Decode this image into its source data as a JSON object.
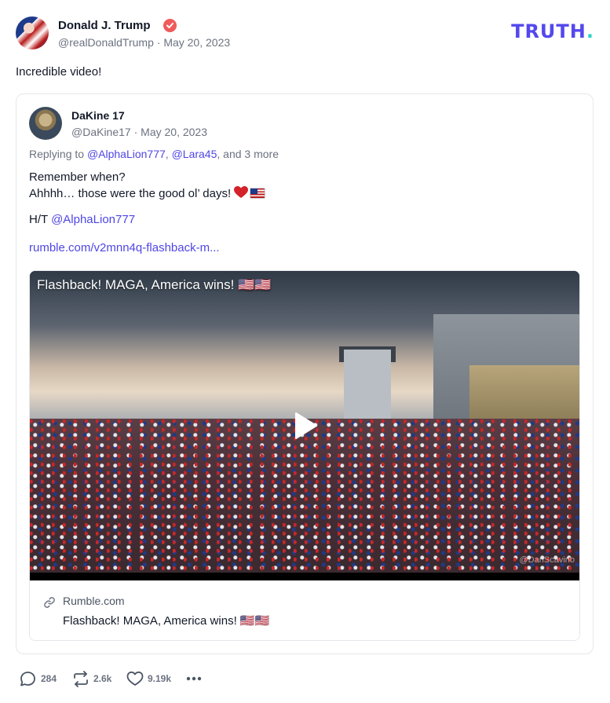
{
  "post": {
    "author_name": "Donald J. Trump",
    "handle": "@realDonaldTrump",
    "date": "May 20, 2023",
    "text": "Incredible video!"
  },
  "brand": {
    "name": "TRUTH",
    "dot": "."
  },
  "quote": {
    "author_name": "DaKine 17",
    "handle": "@DaKine17",
    "date": "May 20, 2023",
    "reply_prefix": "Replying to ",
    "reply_user1": "@AlphaLion777",
    "reply_sep": ", ",
    "reply_user2": "@Lara45",
    "reply_suffix": ", and 3 more",
    "line1": "Remember when?",
    "line2": "Ahhhh… those were the good ol’ days!",
    "ht_prefix": "H/T ",
    "ht_user": "@AlphaLion777",
    "url": "rumble.com/v2mnn4q-flashback-m..."
  },
  "media": {
    "video_title": "Flashback! MAGA, America wins! 🇺🇸🇺🇸",
    "watermark": "@DanScavino",
    "link_domain": "Rumble.com",
    "link_title": "Flashback! MAGA, America wins! 🇺🇸🇺🇸"
  },
  "actions": {
    "replies": "284",
    "retruths": "2.6k",
    "likes": "9.19k"
  },
  "icons": [
    "verified-badge-icon",
    "link-icon",
    "play-icon",
    "reply-icon",
    "retruth-icon",
    "like-icon",
    "more-icon",
    "heart-emoji-icon",
    "us-flag-emoji-icon"
  ],
  "colors": {
    "accent": "#4f46e5",
    "brand": "#5448ee",
    "brand_dot": "#2ad2c9",
    "verified": "#f05a5a",
    "muted": "#6b7280"
  }
}
